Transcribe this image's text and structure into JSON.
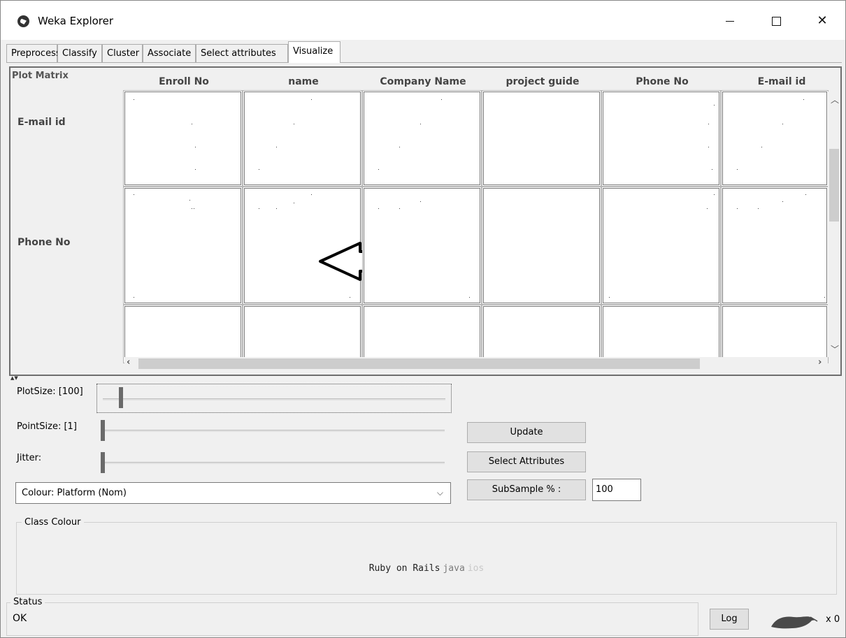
{
  "window": {
    "title": "Weka Explorer"
  },
  "tabs": [
    {
      "label": "Preprocess"
    },
    {
      "label": "Classify"
    },
    {
      "label": "Cluster"
    },
    {
      "label": "Associate"
    },
    {
      "label": "Select attributes"
    },
    {
      "label": "Visualize"
    }
  ],
  "active_tab": "Visualize",
  "plot_matrix": {
    "label": "Plot Matrix",
    "columns": [
      "Enroll No",
      "name",
      "Company Name",
      "project guide",
      "Phone No",
      "E-mail id"
    ],
    "rows": [
      "E-mail id",
      "Phone No"
    ]
  },
  "controls": {
    "plotsize_label": "PlotSize: [100]",
    "pointsize_label": "PointSize: [1]",
    "jitter_label": "Jitter:",
    "plotsize_value": 100,
    "pointsize_value": 1,
    "jitter_value": 0,
    "update_button": "Update",
    "select_attributes_button": "Select Attributes",
    "subsample_button": "SubSample % :",
    "subsample_value": "100",
    "colour_select": "Colour: Platform (Nom)"
  },
  "class_colour": {
    "title": "Class Colour",
    "items": [
      {
        "label": "Ruby on Rails",
        "color": "#222222"
      },
      {
        "label": "java",
        "color": "#7a7a7a"
      },
      {
        "label": "ios",
        "color": "#c8c8c8"
      }
    ]
  },
  "status": {
    "title": "Status",
    "text": "OK",
    "log_button": "Log",
    "task_count": "x 0"
  }
}
